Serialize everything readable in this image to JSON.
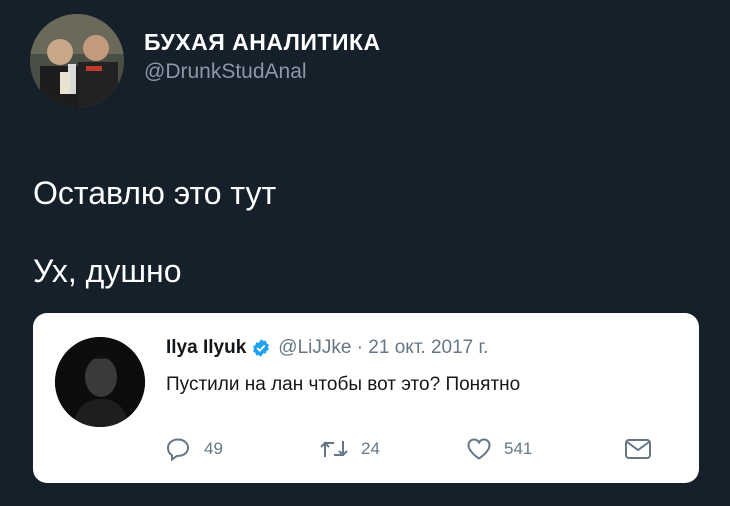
{
  "author": {
    "display_name": "БУХАЯ АНАЛИТИКА",
    "handle": "@DrunkStudAnal"
  },
  "tweet": {
    "lines": [
      "Оставлю это тут",
      "Ух, душно"
    ]
  },
  "quoted_tweet": {
    "name": "Ilya Ilyuk",
    "meta": "@LiJJke · 21 окт. 2017 г.",
    "text": "Пустили на лан чтобы вот это? Понятно",
    "replies": "49",
    "retweets": "24",
    "likes": "541",
    "icons": [
      "reply-icon",
      "retweet-icon",
      "like-icon",
      "message-icon",
      "verified-icon"
    ]
  },
  "colors": {
    "background": "#15202b",
    "card": "#ffffff",
    "verified": "#1da1f2",
    "muted": "#657786"
  }
}
